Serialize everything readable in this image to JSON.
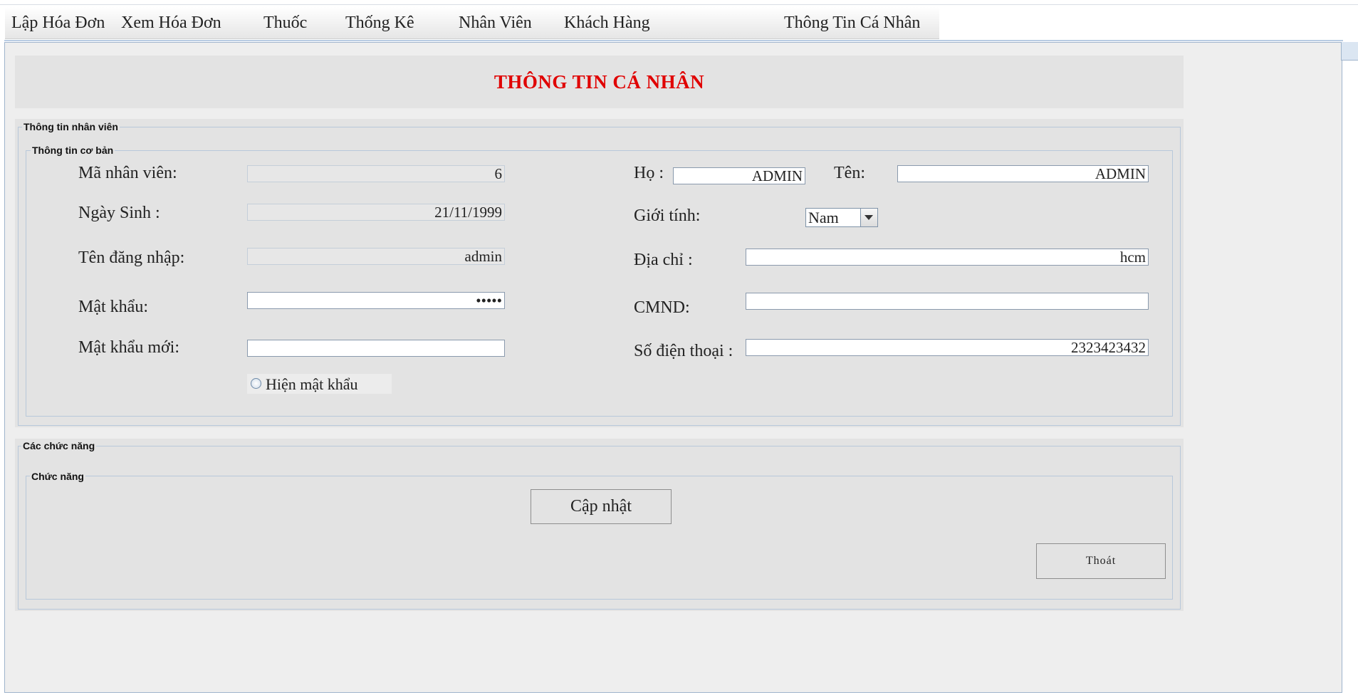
{
  "menu": {
    "items": [
      {
        "label": "Lập Hóa Đơn"
      },
      {
        "label": "Xem Hóa Đơn"
      },
      {
        "label": "Thuốc"
      },
      {
        "label": "Thống Kê"
      },
      {
        "label": "Nhân Viên"
      },
      {
        "label": "Khách Hàng"
      },
      {
        "label": "Thông Tin Cá Nhân"
      }
    ]
  },
  "page": {
    "title": "THÔNG TIN CÁ NHÂN",
    "title_color": "#e00000"
  },
  "employee_section": {
    "legend": "Thông tin nhân viên",
    "basic_legend": "Thông tin cơ bản",
    "fields": {
      "employee_id": {
        "label": "Mã nhân viên:",
        "value": "6"
      },
      "birthdate": {
        "label": "Ngày Sinh :",
        "value": "21/11/1999"
      },
      "username": {
        "label": "Tên đăng nhập:",
        "value": "admin"
      },
      "password": {
        "label": "Mật khẩu:",
        "value": "•••••"
      },
      "new_password": {
        "label": "Mật khẩu mới:",
        "value": ""
      },
      "last_name": {
        "label": "Họ :",
        "value": "ADMIN"
      },
      "first_name": {
        "label": "Tên:",
        "value": "ADMIN"
      },
      "gender": {
        "label": "Giới tính:",
        "value": "Nam"
      },
      "address": {
        "label": "Địa chỉ :",
        "value": "hcm"
      },
      "id_card": {
        "label": "CMND:",
        "value": ""
      },
      "phone": {
        "label": "Số điện thoại :",
        "value": "2323423432"
      }
    },
    "show_password_label": "Hiện mật khẩu"
  },
  "functions_section": {
    "legend": "Các chức năng",
    "inner_legend": "Chức năng",
    "update_label": "Cập nhật",
    "exit_label": "Thoát"
  }
}
